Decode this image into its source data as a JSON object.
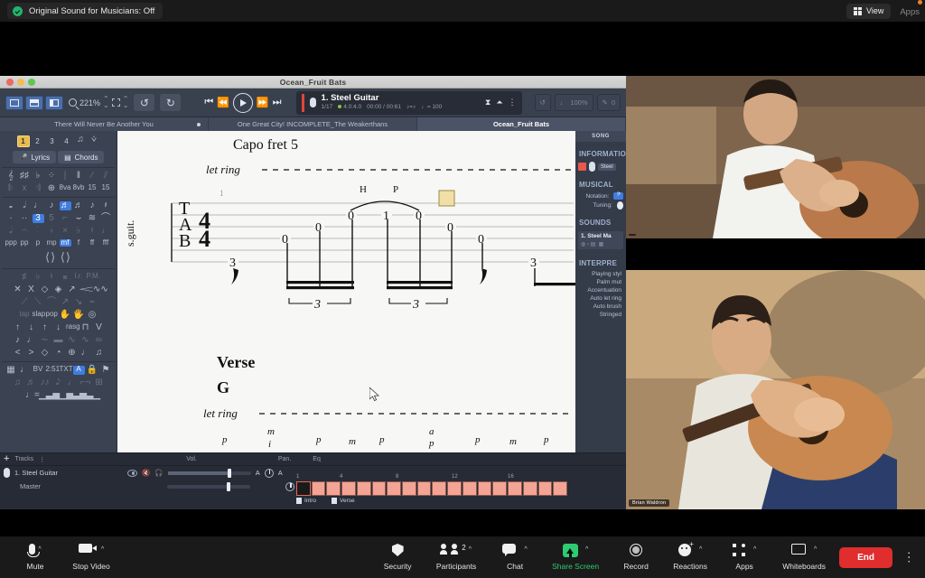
{
  "zoom_top": {
    "original_sound": "Original Sound for Musicians: Off",
    "view_label": "View",
    "apps_label": "Apps"
  },
  "guitar_pro": {
    "window_title": "Ocean_Fruit Bats",
    "toolbar": {
      "zoom_level": "221%",
      "undo": "↺",
      "redo": "↻",
      "loop_icon": "loop-icon",
      "tempo_percent": "100%",
      "transpose_value": "0"
    },
    "track_chip": {
      "name": "1. Steel Guitar",
      "track_index": "1/17",
      "strings_tuning": "4.0:4.0",
      "time": "00:00 / 00:61",
      "feel": "♪=♪",
      "tempo": "♩= 100"
    },
    "document_tabs": [
      {
        "label": "There Will Never Be Another You",
        "active": false,
        "modified": true
      },
      {
        "label": "One Great City! INCOMPLETE_The Weakerthans",
        "active": false,
        "modified": false
      },
      {
        "label": "Ocean_Fruit Bats",
        "active": true,
        "modified": false
      }
    ],
    "palette": {
      "voice_numbers": [
        "1",
        "2",
        "3",
        "4"
      ],
      "selected_voice": "1",
      "lyrics_label": "Lyrics",
      "chords_label": "Chords"
    },
    "score": {
      "capo_text": "Capo fret 5",
      "let_ring_text": "let ring",
      "instrument_label": "s.guit.",
      "clef_text": "TAB",
      "time_signature": "4/4",
      "measure_number": "1",
      "system1_tab_numbers": [
        "3",
        "0",
        "0",
        "0",
        "1",
        "0",
        "0",
        "0",
        "3"
      ],
      "hammer_label": "H",
      "pull_label": "P",
      "tuplets": [
        "3",
        "3"
      ],
      "section_label": "Verse",
      "chord_label": "G",
      "let_ring_text2": "let ring",
      "fingerings": [
        "p",
        "m",
        "i",
        "p",
        "m",
        "p",
        "a",
        "p",
        "p",
        "m",
        "p"
      ]
    },
    "inspector": {
      "header": "SONG",
      "information": {
        "title": "INFORMATION",
        "track_chip": "Steel"
      },
      "musical": {
        "title": "MUSICAL",
        "notation_label": "Notation:",
        "notation_value": "𝄢",
        "tuning_label": "Tuning:"
      },
      "sounds": {
        "title": "SOUNDS",
        "item": "1. Steel Ma"
      },
      "interpretation": {
        "title": "INTERPRE",
        "rows": [
          "Playing styl",
          "Palm mut",
          "Accentuation",
          "Auto let ring",
          "Auto brush",
          "Stringed"
        ]
      }
    },
    "tracks_panel": {
      "add_label": "+",
      "header_tracks": "Tracks",
      "header_vol": "Vol.",
      "header_pan": "Pan.",
      "header_eq": "Eq",
      "rows": [
        {
          "name": "1. Steel Guitar",
          "eq_label": "A"
        },
        {
          "name": "Master",
          "eq_label": ""
        }
      ],
      "timeline": {
        "measure_ticks": [
          "1",
          "4",
          "8",
          "12",
          "16"
        ],
        "bar_count": 18,
        "current_bar": 1,
        "sections": [
          "Intro",
          "Verse"
        ]
      }
    }
  },
  "videos": [
    {
      "name": "",
      "position": "top"
    },
    {
      "name": "Brian Waldron",
      "position": "bottom"
    }
  ],
  "zoom_bottom": {
    "items": [
      {
        "label": "Mute",
        "icon": "microphone-icon",
        "caret": true
      },
      {
        "label": "Stop Video",
        "icon": "camera-icon",
        "caret": true
      },
      {
        "label": "Security",
        "icon": "shield-icon",
        "caret": false
      },
      {
        "label": "Participants",
        "icon": "participants-icon",
        "caret": true,
        "badge": "2"
      },
      {
        "label": "Chat",
        "icon": "chat-icon",
        "caret": true
      },
      {
        "label": "Share Screen",
        "icon": "share-screen-icon",
        "caret": true,
        "highlight": "#2ecc71"
      },
      {
        "label": "Record",
        "icon": "record-icon",
        "caret": false
      },
      {
        "label": "Reactions",
        "icon": "reactions-icon",
        "caret": true
      },
      {
        "label": "Apps",
        "icon": "apps-icon",
        "caret": true
      },
      {
        "label": "Whiteboards",
        "icon": "whiteboard-icon",
        "caret": true
      }
    ],
    "end_label": "End",
    "more_icon": "kebab-menu-icon"
  },
  "colors": {
    "zoom_bar": "#1a1a1a",
    "end_red": "#e02d2d",
    "share_green": "#2ecc71",
    "gp_chrome": "#39404e",
    "timeline_bar": "#f4a494",
    "accent_blue": "#3f7de0"
  }
}
